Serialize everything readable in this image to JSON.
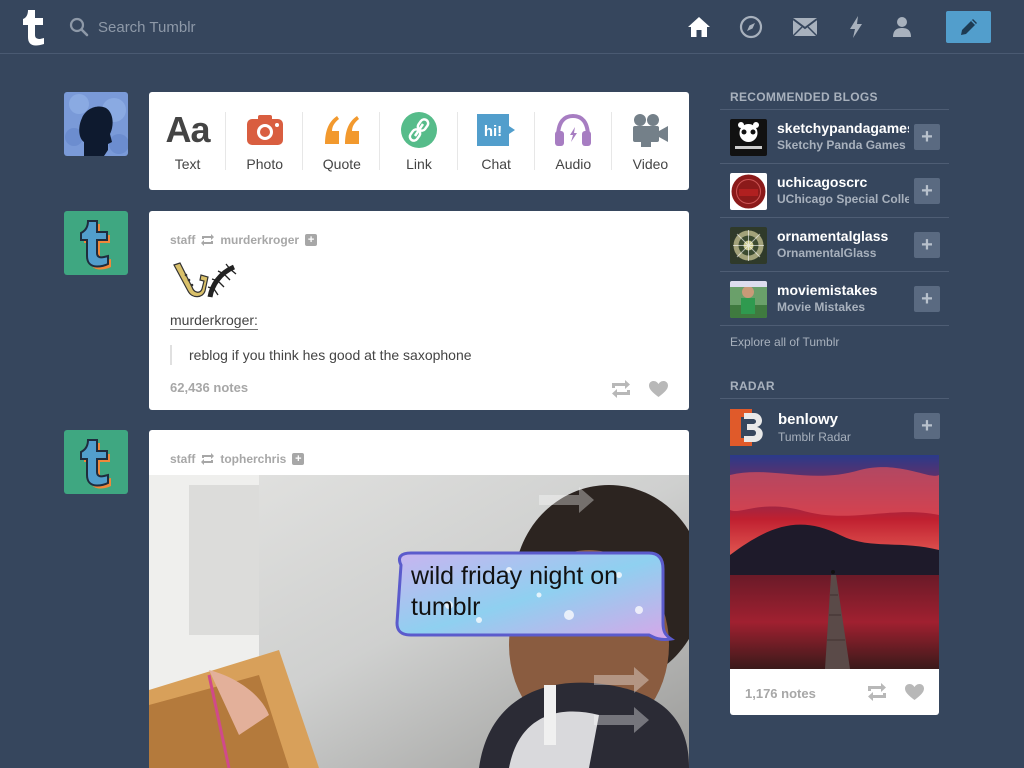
{
  "header": {
    "search_placeholder": "Search Tumblr",
    "accent": "#529ecc",
    "background": "#36465d"
  },
  "post_types": [
    {
      "label": "Text",
      "icon": "text-icon",
      "color": "#444444"
    },
    {
      "label": "Photo",
      "icon": "camera-icon",
      "color": "#d95e40"
    },
    {
      "label": "Quote",
      "icon": "quote-icon",
      "color": "#f2992e"
    },
    {
      "label": "Link",
      "icon": "link-icon",
      "color": "#56bc8a"
    },
    {
      "label": "Chat",
      "icon": "chat-icon",
      "color": "#529ecc"
    },
    {
      "label": "Audio",
      "icon": "headphones-icon",
      "color": "#a77dc2"
    },
    {
      "label": "Video",
      "icon": "video-camera-icon",
      "color": "#748089"
    }
  ],
  "posts": [
    {
      "blog": "staff",
      "source": "murderkroger",
      "quote_author": "murderkroger:",
      "quote_text": "reblog if you think hes good at the saxophone",
      "notes": "62,436 notes"
    },
    {
      "blog": "staff",
      "source": "topherchris",
      "caption_line1": "wild friday night on",
      "caption_line2": "tumblr"
    }
  ],
  "sidebar": {
    "recommended_title": "RECOMMENDED BLOGS",
    "blogs": [
      {
        "name": "sketchypandagames",
        "title": "Sketchy Panda Games"
      },
      {
        "name": "uchicagoscrc",
        "title": "UChicago Special Collections"
      },
      {
        "name": "ornamentalglass",
        "title": "OrnamentalGlass"
      },
      {
        "name": "moviemistakes",
        "title": "Movie Mistakes"
      }
    ],
    "explore_label": "Explore all of Tumblr",
    "radar_title": "RADAR",
    "radar": {
      "name": "benlowy",
      "subtitle": "Tumblr Radar",
      "notes": "1,176 notes"
    }
  }
}
